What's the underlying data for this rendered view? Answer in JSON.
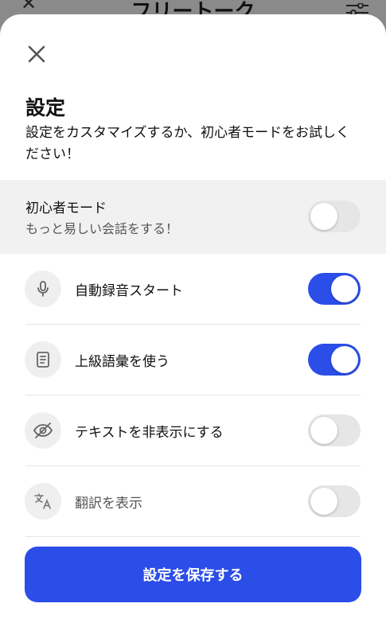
{
  "background_header": {
    "title": "フリートーク"
  },
  "sheet": {
    "title": "設定",
    "description": "設定をカスタマイズするか、初心者モードをお試しください！",
    "beginner_mode": {
      "title": "初心者モード",
      "subtitle": "もっと易しい会話をする！",
      "enabled": false
    },
    "settings": [
      {
        "label": "自動録音スタート",
        "icon": "microphone-icon",
        "enabled": true
      },
      {
        "label": "上級語彙を使う",
        "icon": "book-icon",
        "enabled": true
      },
      {
        "label": "テキストを非表示にする",
        "icon": "eye-off-icon",
        "enabled": false
      },
      {
        "label": "翻訳を表示",
        "icon": "translate-icon",
        "enabled": false
      }
    ],
    "save_label": "設定を保存する"
  },
  "colors": {
    "accent": "#2b4de8",
    "toggle_off": "#e6e6e6",
    "beginner_bg": "#f1f1f1"
  }
}
